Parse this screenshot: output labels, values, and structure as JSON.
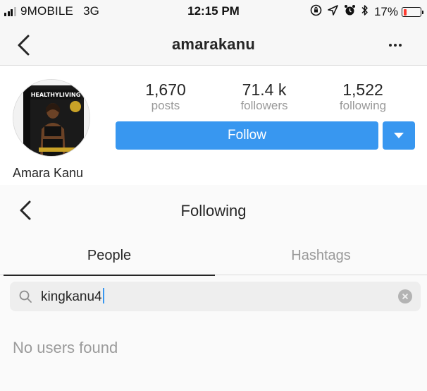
{
  "status_bar": {
    "carrier": "9MOBILE",
    "network": "3G",
    "time": "12:15 PM",
    "battery": "17%",
    "icons": [
      "signal-icon",
      "rotation-lock-icon",
      "location-icon",
      "alarm-icon",
      "bluetooth-icon",
      "battery-icon"
    ],
    "battery_level": 0.17,
    "battery_color": "#ff3b30"
  },
  "profile": {
    "username": "amarakanu",
    "display_name": "Amara Kanu",
    "avatar_text": "HEALTHYLIVING",
    "stats": [
      {
        "value": "1,670",
        "label": "posts"
      },
      {
        "value": "71.4 k",
        "label": "followers"
      },
      {
        "value": "1,522",
        "label": "following"
      }
    ],
    "follow_label": "Follow",
    "accent": "#3897f0"
  },
  "following": {
    "title": "Following",
    "tabs": [
      {
        "label": "People",
        "active": true
      },
      {
        "label": "Hashtags",
        "active": false
      }
    ],
    "search": {
      "value": "kingkanu4"
    },
    "empty_message": "No users found"
  }
}
